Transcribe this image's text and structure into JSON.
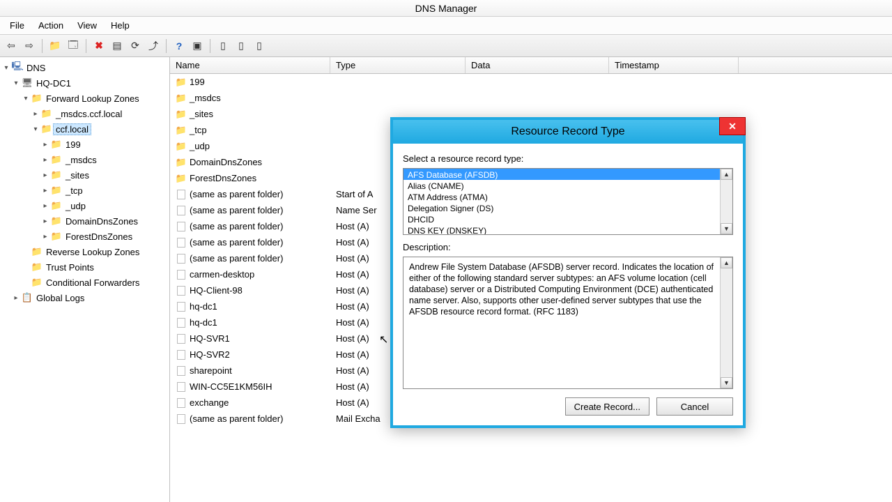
{
  "window": {
    "title": "DNS Manager"
  },
  "menu": {
    "file": "File",
    "action": "Action",
    "view": "View",
    "help": "Help"
  },
  "tree": {
    "root": "DNS",
    "server": "HQ-DC1",
    "fwd": "Forward Lookup Zones",
    "msdcs_ccf": "_msdcs.ccf.local",
    "ccf": "ccf.local",
    "z199": "199",
    "zmsdcs": "_msdcs",
    "zsites": "_sites",
    "ztcp": "_tcp",
    "zudp": "_udp",
    "domaindns": "DomainDnsZones",
    "forestdns": "ForestDnsZones",
    "rev": "Reverse Lookup Zones",
    "trust": "Trust Points",
    "cond": "Conditional Forwarders",
    "global": "Global Logs"
  },
  "columns": {
    "name": "Name",
    "type": "Type",
    "data": "Data",
    "ts": "Timestamp"
  },
  "rows": [
    {
      "name": "199",
      "type": "",
      "folder": true
    },
    {
      "name": "_msdcs",
      "type": "",
      "folder": true
    },
    {
      "name": "_sites",
      "type": "",
      "folder": true
    },
    {
      "name": "_tcp",
      "type": "",
      "folder": true
    },
    {
      "name": "_udp",
      "type": "",
      "folder": true
    },
    {
      "name": "DomainDnsZones",
      "type": "",
      "folder": true
    },
    {
      "name": "ForestDnsZones",
      "type": "",
      "folder": true
    },
    {
      "name": "(same as parent folder)",
      "type": "Start of A",
      "folder": false
    },
    {
      "name": "(same as parent folder)",
      "type": "Name Ser",
      "folder": false
    },
    {
      "name": "(same as parent folder)",
      "type": "Host (A)",
      "folder": false
    },
    {
      "name": "(same as parent folder)",
      "type": "Host (A)",
      "folder": false
    },
    {
      "name": "(same as parent folder)",
      "type": "Host (A)",
      "folder": false
    },
    {
      "name": "carmen-desktop",
      "type": "Host (A)",
      "folder": false
    },
    {
      "name": "HQ-Client-98",
      "type": "Host (A)",
      "folder": false
    },
    {
      "name": "hq-dc1",
      "type": "Host (A)",
      "folder": false
    },
    {
      "name": "hq-dc1",
      "type": "Host (A)",
      "folder": false
    },
    {
      "name": "HQ-SVR1",
      "type": "Host (A)",
      "folder": false
    },
    {
      "name": "HQ-SVR2",
      "type": "Host (A)",
      "folder": false
    },
    {
      "name": "sharepoint",
      "type": "Host (A)",
      "folder": false
    },
    {
      "name": "WIN-CC5E1KM56IH",
      "type": "Host (A)",
      "folder": false
    },
    {
      "name": "exchange",
      "type": "Host (A)",
      "folder": false
    },
    {
      "name": "(same as parent folder)",
      "type": "Mail Excha",
      "folder": false
    }
  ],
  "dialog": {
    "title": "Resource Record Type",
    "select_label": "Select a resource record type:",
    "options": [
      "AFS Database (AFSDB)",
      "Alias (CNAME)",
      "ATM Address (ATMA)",
      "Delegation Signer (DS)",
      "DHCID",
      "DNS KEY (DNSKEY)"
    ],
    "desc_label": "Description:",
    "description": "Andrew File System Database (AFSDB) server record. Indicates the location of either of the following standard server subtypes: an AFS volume location (cell database) server or a Distributed Computing Environment (DCE) authenticated name server. Also, supports other user-defined server subtypes that use the AFSDB resource record format. (RFC 1183)",
    "create": "Create Record...",
    "cancel": "Cancel"
  }
}
